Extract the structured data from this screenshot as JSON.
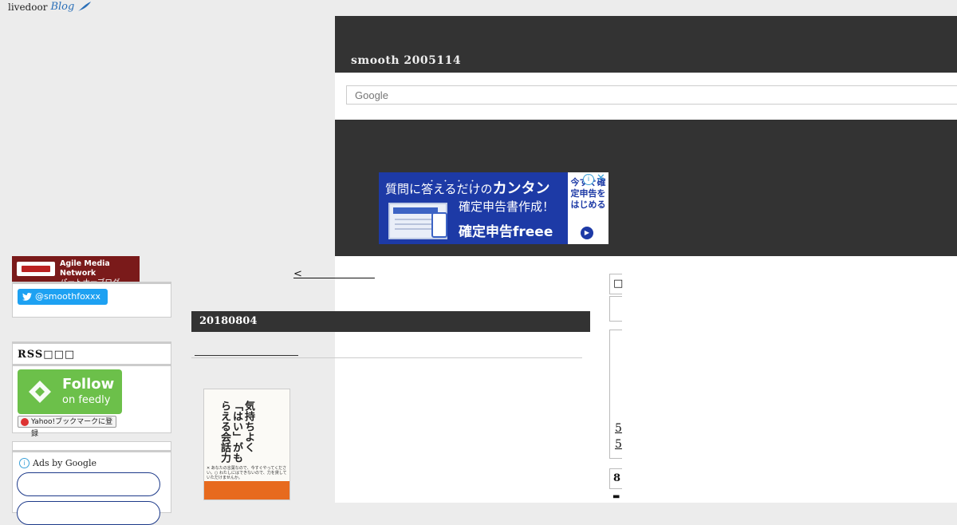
{
  "topbar": {
    "brand": "livedoor",
    "brand_suffix": "Blog"
  },
  "blog": {
    "title": "smooth 2005114"
  },
  "search": {
    "placeholder": "Google"
  },
  "ad": {
    "line1_prefix": "質問に答えるだけの",
    "line1_emphasis": "カンタン",
    "dots": "・・・・",
    "line2": "確定申告書作成！",
    "line3": "確定申告freee",
    "side_text": "今すぐ確定申告をはじめる",
    "info_glyph": "i",
    "close_glyph": "✕",
    "play_glyph": "▶"
  },
  "sidebar": {
    "amn_line1": "Agile Media Network",
    "amn_line2": "パートナーブログ",
    "twitter_handle": "@smoothfoxxx",
    "rss_title": "RSS□□□",
    "feedly_follow": "Follow",
    "feedly_on": "on feedly",
    "yahoo_bookmark": "Yahoo!ブックマークに登録",
    "ads_by_google": "Ads by Google",
    "ads_info_glyph": "i"
  },
  "main": {
    "prev_link": "<　　　　　　　",
    "date": "20180804",
    "book_title": "気持ちよく「はい」がもらえる会話力",
    "book_sub": "✕ あなたの言葉なので、今すぐやってください。○ わたしにはできないので、力を貸していただけませんか。"
  },
  "right_col": {
    "glyph_top": "□",
    "link_1": "5",
    "link_2": "5",
    "label_bottom": "8",
    "icon_bottom": "▬"
  },
  "colors": {
    "header_bg": "#333333",
    "page_bg": "#ececec",
    "twitter": "#1da1f2",
    "feedly": "#6cc04a",
    "amn": "#7a1a1a",
    "ad_blue": "#1d3aa6"
  }
}
